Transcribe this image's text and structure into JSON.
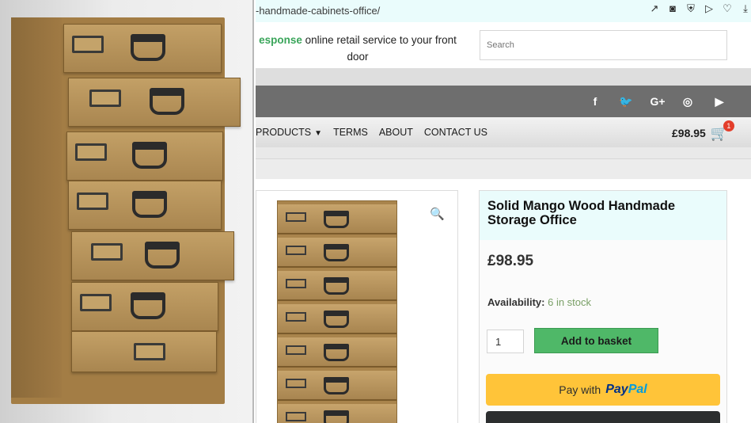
{
  "url": {
    "text": "-handmade-cabinets-office/",
    "icons": [
      "share-icon",
      "camera-icon",
      "shield-icon",
      "send-icon",
      "heart-icon",
      "download-icon"
    ]
  },
  "header": {
    "tagline_highlight": "esponse",
    "tagline_rest": " online retail service to your front door",
    "search_placeholder": "Search"
  },
  "social": {
    "icons": [
      {
        "name": "facebook-icon",
        "glyph": "f"
      },
      {
        "name": "twitter-icon",
        "glyph": "t"
      },
      {
        "name": "googleplus-icon",
        "glyph": "G+"
      },
      {
        "name": "instagram-icon",
        "glyph": "◎"
      },
      {
        "name": "youtube-icon",
        "glyph": "▶"
      }
    ]
  },
  "nav": {
    "items": [
      "PRODUCTS",
      "TERMS",
      "ABOUT",
      "CONTACT US"
    ],
    "cart_total": "£98.95",
    "cart_count": "1"
  },
  "product": {
    "title": "Solid Mango Wood Handmade Storage Office",
    "price": "£98.95",
    "availability_label": "Availability:",
    "availability_value": "6 in stock",
    "quantity": "1",
    "add_button": "Add to basket",
    "paypal_prefix": "Pay with",
    "paypal_brand_1": "Pay",
    "paypal_brand_2": "Pal"
  },
  "colors": {
    "accent_green": "#4fb868",
    "social_bar": "#6e6e6e",
    "paypal_yellow": "#ffc439",
    "stock_green": "#7aa067"
  }
}
